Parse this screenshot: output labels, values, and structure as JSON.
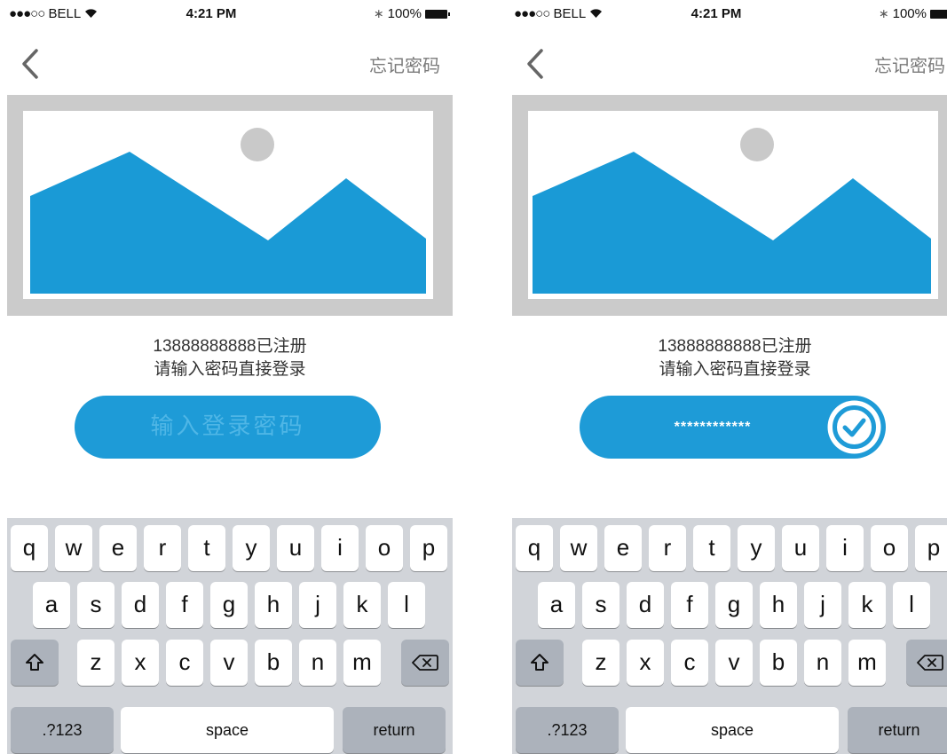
{
  "status_bar": {
    "signal_dots": "●●●○○",
    "carrier": "BELL",
    "wifi_icon": "wifi-icon",
    "time": "4:21 PM",
    "bluetooth_icon": "bluetooth-icon",
    "battery_percent": "100%"
  },
  "nav": {
    "back_icon": "chevron-left-icon",
    "forgot_password": "忘记密码"
  },
  "message": {
    "line1": "13888888888已注册",
    "line2": "请输入密码直接登录"
  },
  "screens": {
    "left": {
      "password_placeholder": "输入登录密码"
    },
    "right": {
      "password_masked": "************",
      "confirm_icon": "checkmark-circle-icon"
    }
  },
  "keyboard": {
    "row1": [
      "q",
      "w",
      "e",
      "r",
      "t",
      "y",
      "u",
      "i",
      "o",
      "p"
    ],
    "row2": [
      "a",
      "s",
      "d",
      "f",
      "g",
      "h",
      "j",
      "k",
      "l"
    ],
    "row3": [
      "z",
      "x",
      "c",
      "v",
      "b",
      "n",
      "m"
    ],
    "shift_icon": "shift-icon",
    "delete_icon": "backspace-icon",
    "numbers_label": ".?123",
    "space_label": "space",
    "return_label": "return"
  },
  "colors": {
    "accent": "#1e9bd7",
    "image_frame": "#cbcbcb",
    "keyboard_bg": "#d1d4d9",
    "key_dark": "#acb2bb"
  }
}
